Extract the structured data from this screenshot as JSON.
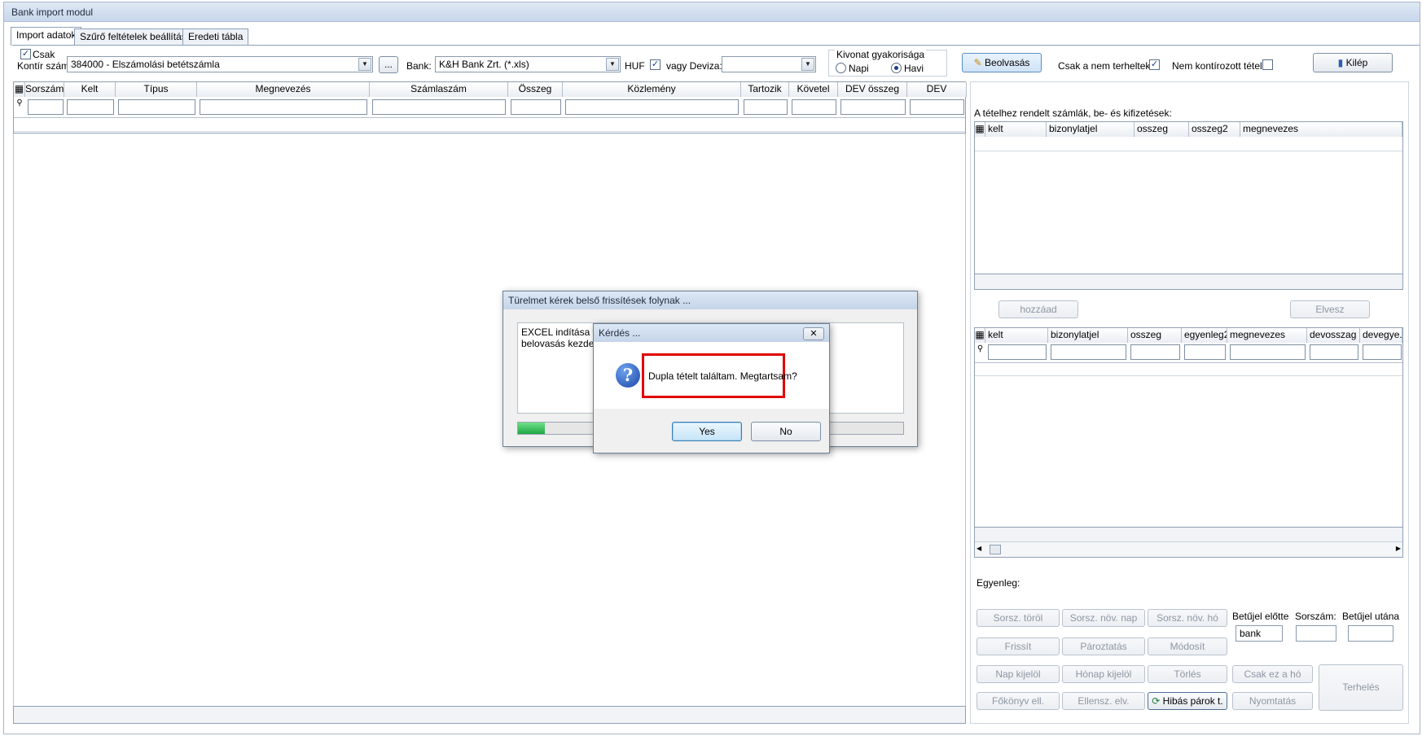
{
  "window": {
    "title": "Bank import modul"
  },
  "tabs": [
    "Import adatok",
    "Szűrő feltételek beállítása",
    "Eredeti tábla"
  ],
  "toolbar": {
    "csak_label": "Csak",
    "kontir_label": "Kontír szám:",
    "kontir_value": "384000 - Elszámolási betétszámla",
    "browse_label": "...",
    "bank_label": "Bank:",
    "bank_value": "K&H Bank Zrt. (*.xls)",
    "huf_label": "HUF",
    "deviza_label": "vagy Deviza:",
    "deviza_value": "",
    "kivonat_label": "Kivonat gyakorisága",
    "napi_label": "Napi",
    "havi_label": "Havi",
    "beolvasas_label": "Beolvasás",
    "csak_nem_terheltek_label": "Csak a nem terheltek",
    "nem_kontirozott_label": "Nem kontírozott tétel.",
    "kilep_label": "Kilép"
  },
  "main_grid": {
    "columns": [
      "Sorszám",
      "Kelt",
      "Típus",
      "Megnevezés",
      "Számlaszám",
      "Összeg",
      "Közlemény",
      "Tartozik",
      "Követel",
      "DEV összeg",
      "DEV"
    ]
  },
  "right_panel": {
    "caption": "A tételhez rendelt számlák, be- és kifizetések:",
    "grid1_columns": [
      "kelt",
      "bizonylatjel",
      "osszeg",
      "osszeg2",
      "megnevezes"
    ],
    "hozzaad_label": "hozzáad",
    "elvesz_label": "Elvesz",
    "grid2_columns": [
      "kelt",
      "bizonylatjel",
      "osszeg",
      "egyenleg2",
      "megnevezes",
      "devosszag",
      "devegye..."
    ],
    "egyenleg_label": "Egyenleg:",
    "betujel_elotte_label": "Betűjel előtte",
    "sorszam_label": "Sorszám:",
    "betujel_utana_label": "Betűjel utána",
    "betujel_elotte_value": "bank",
    "buttons_row1": [
      "Sorsz. töröl",
      "Sorsz. növ. nap",
      "Sorsz. növ. hó"
    ],
    "buttons_row2": [
      "Frissít",
      "Pároztatás",
      "Módosít"
    ],
    "buttons_row3": [
      "Nap kijelöl",
      "Hónap kijelöl",
      "Törlés",
      "Csak ez a hó"
    ],
    "buttons_row4": [
      "Főkönyv ell.",
      "Ellensz. elv.",
      "Hibás párok t.",
      "Nyomtatás"
    ],
    "terheles_label": "Terhelés"
  },
  "progress_dialog": {
    "title": "Türelmet kérek belső frissítések folynak ...",
    "line1": "EXCEL indítása fol",
    "line2": "belovasás kezdete",
    "progress": 0.07
  },
  "question_dialog": {
    "title": "Kérdés ...",
    "message": "Dupla tételt találtam. Megtartsam?",
    "yes_label": "Yes",
    "no_label": "No"
  },
  "colors": {
    "highlight_border": "#e00000",
    "progress_fill": "#22b14c"
  }
}
